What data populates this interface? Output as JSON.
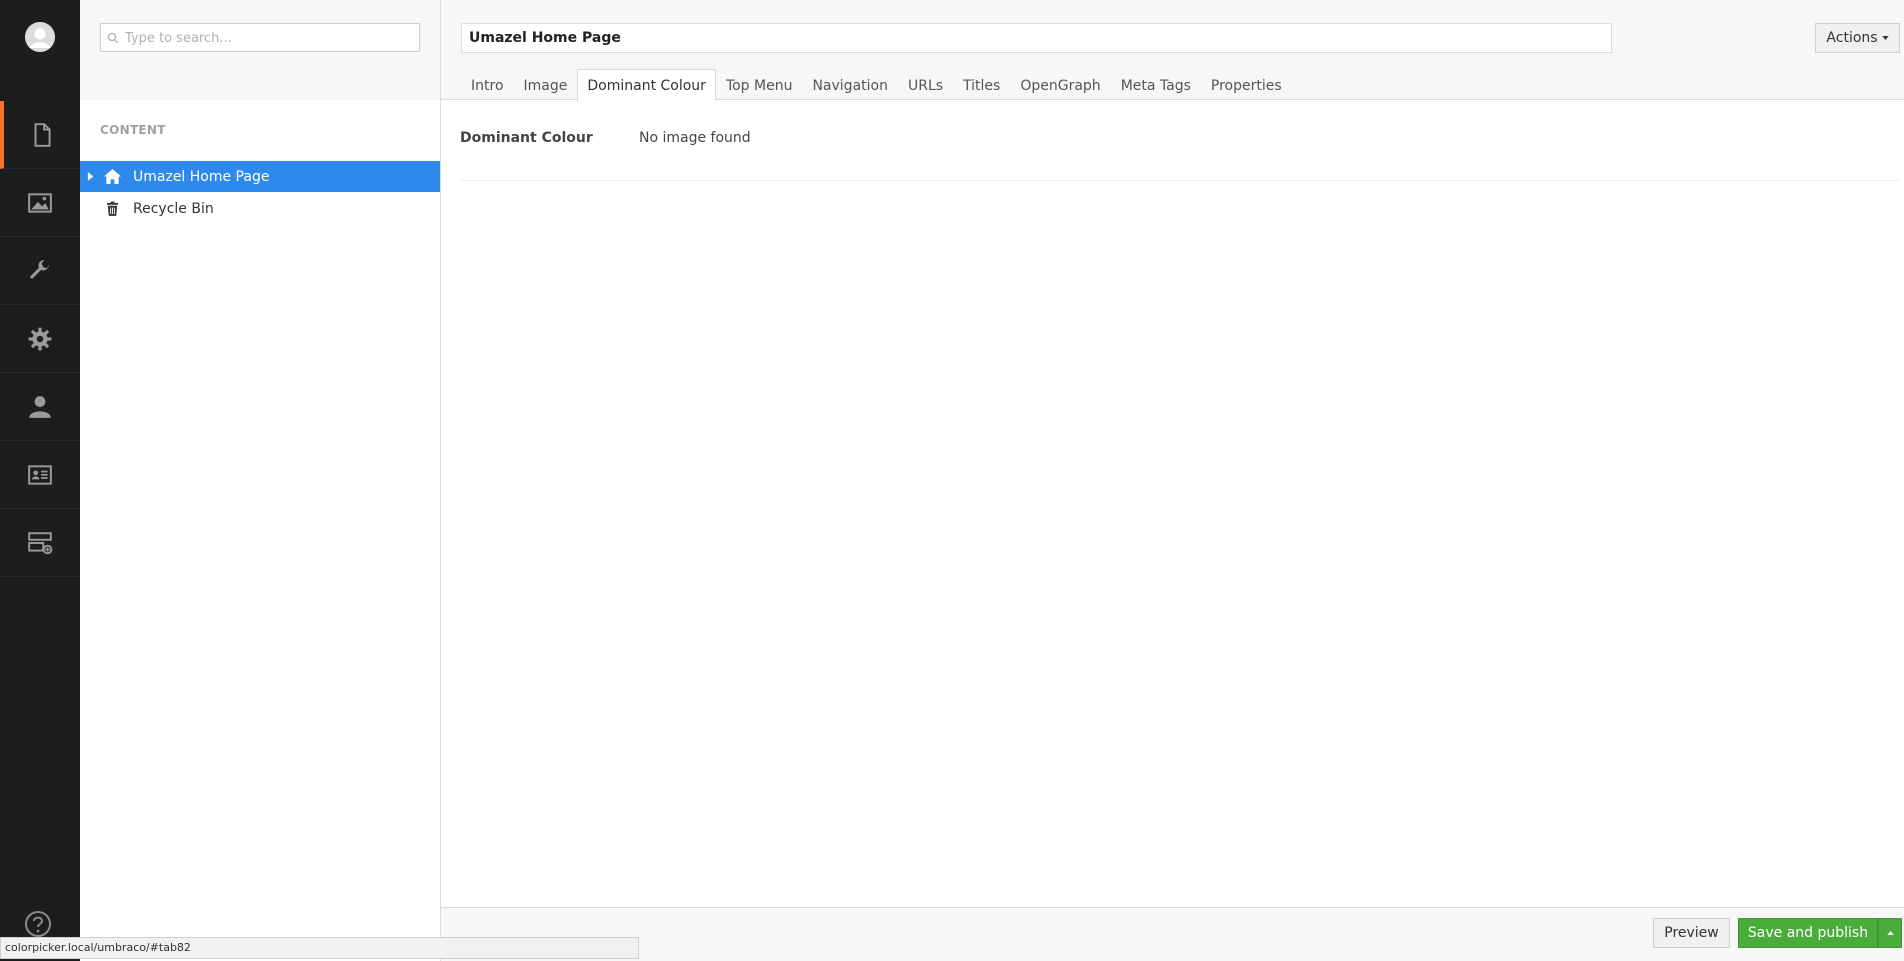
{
  "tree": {
    "search_placeholder": "Type to search...",
    "heading": "CONTENT",
    "nodes": [
      {
        "label": "Umazel Home Page",
        "icon": "home-icon",
        "selected": true
      },
      {
        "label": "Recycle Bin",
        "icon": "trash-icon",
        "selected": false
      }
    ]
  },
  "appbar": {
    "sections": [
      "content-icon",
      "media-icon",
      "settings-wrench-icon",
      "developer-gear-icon",
      "users-icon",
      "members-icon",
      "forms-icon"
    ],
    "accent_color": "#f5732b"
  },
  "header": {
    "name_value": "Umazel Home Page",
    "actions_label": "Actions",
    "tabs": [
      "Intro",
      "Image",
      "Dominant Colour",
      "Top Menu",
      "Navigation",
      "URLs",
      "Titles",
      "OpenGraph",
      "Meta Tags",
      "Properties"
    ],
    "active_tab": "Dominant Colour"
  },
  "property": {
    "label": "Dominant Colour",
    "value": "No image found"
  },
  "footer": {
    "preview_label": "Preview",
    "publish_label": "Save and publish"
  },
  "status_url": "colorpicker.local/umbraco/#tab82",
  "colors": {
    "selected_node": "#2e8aea",
    "publish_button": "#4aac3b",
    "appbar": "#1d1d1d"
  }
}
